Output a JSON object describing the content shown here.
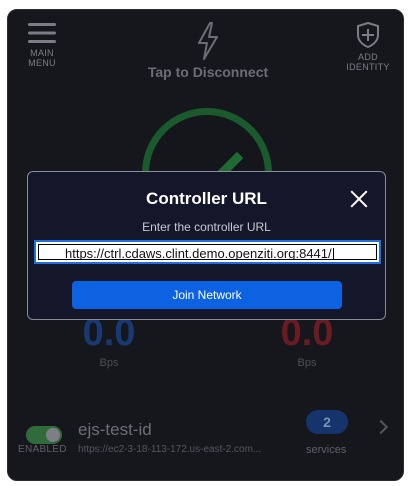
{
  "header": {
    "menu_label_line1": "MAIN",
    "menu_label_line2": "MENU",
    "center_label": "Tap to Disconnect",
    "add_label_line1": "ADD",
    "add_label_line2": "IDENTITY"
  },
  "speeds": {
    "download": {
      "value": "0.0",
      "unit": "Bps"
    },
    "upload": {
      "value": "0.0",
      "unit": "Bps"
    }
  },
  "identity": {
    "toggle_label": "ENABLED",
    "name": "ejs-test-id",
    "url": "https://ec2-3-18-113-172.us-east-2.com...",
    "services_count": "2",
    "services_label": "services"
  },
  "modal": {
    "title": "Controller URL",
    "subtitle": "Enter the controller URL",
    "input_value": "https://ctrl.cdaws.clint.demo.openziti.org:8441/",
    "button_label": "Join Network"
  },
  "colors": {
    "background": "#16171d",
    "modal_bg": "#14162a",
    "accent": "#0c62e0",
    "connected_green": "#1b5a2c"
  },
  "icons": {
    "menu": "hamburger-icon",
    "lightning": "lightning-icon",
    "add_identity": "shield-plus-icon",
    "close": "close-icon",
    "chevron": "chevron-right-icon"
  }
}
